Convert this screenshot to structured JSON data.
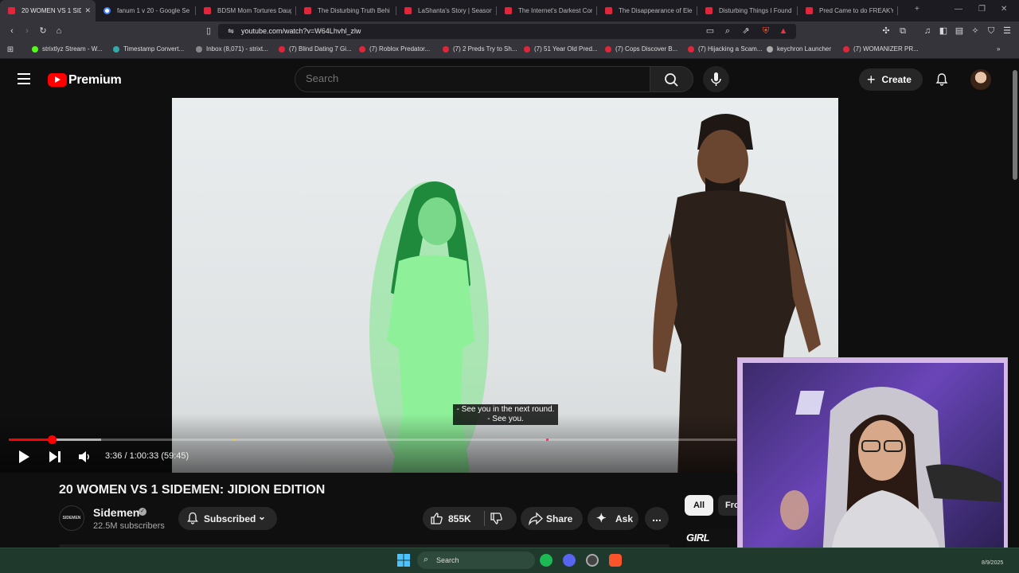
{
  "browser": {
    "tabs": [
      {
        "label": "20 WOMEN VS 1 SIDE",
        "active": true,
        "fav": "yt"
      },
      {
        "label": "fanum 1 v 20 - Google Se",
        "fav": "google"
      },
      {
        "label": "BDSM Mom Tortures Daug",
        "fav": "yt"
      },
      {
        "label": "The Disturbing Truth Behi",
        "fav": "yt"
      },
      {
        "label": "LaShanta's Story | Season",
        "fav": "yt"
      },
      {
        "label": "The Internet's Darkest Cor",
        "fav": "yt"
      },
      {
        "label": "The Disappearance of Ele",
        "fav": "yt"
      },
      {
        "label": "Disturbing Things I Found",
        "fav": "yt"
      },
      {
        "label": "Pred Came to do FREAKY",
        "fav": "yt"
      }
    ],
    "url": "youtube.com/watch?v=W64Lhvhl_zlw",
    "bookmarks": [
      "strixtlyz Stream - W...",
      "Timestamp Convert...",
      "Inbox (8,071) - strixt...",
      "(7) Blind Dating 7 Gi...",
      "(7) Roblox Predator...",
      "(7) 2 Preds Try to Sh...",
      "(7) 51 Year Old Pred...",
      "(7) Cops Discover B...",
      "(7) Hijacking a Scam...",
      "keychron Launcher",
      "(7) WOMANIZER PR..."
    ]
  },
  "masthead": {
    "logo_text": "Premium",
    "search_placeholder": "Search",
    "create_label": "Create"
  },
  "player": {
    "caption_line1": "- See you in the next round.",
    "caption_line2": "- See you.",
    "time": "3:36 / 1:00:33 (59:45)",
    "progress_fraction": 0.06,
    "buffer_fraction": 0.127
  },
  "video": {
    "title": "20 WOMEN VS 1 SIDEMEN: JIDION EDITION",
    "channel": "Sidemen",
    "channel_avatar_text": "SIDEMEN",
    "subscribers": "22.5M subscribers",
    "subscribe_label": "Subscribed",
    "likes": "855K",
    "share_label": "Share",
    "ask_label": "Ask",
    "more_label": "..."
  },
  "side": {
    "chip_all": "All",
    "chip_from": "Fro",
    "thumb_text": "GIRL FORC"
  },
  "taskbar": {
    "search_label": "Search",
    "date": "8/9/2025"
  },
  "colors": {
    "accent": "#ff0000",
    "bg": "#0f0f0f",
    "webcam_border": "#d6b8e6"
  }
}
